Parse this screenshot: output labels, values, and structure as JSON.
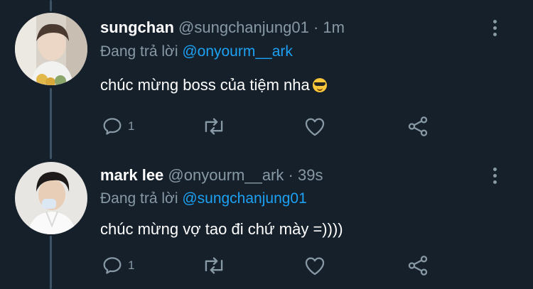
{
  "tweets": [
    {
      "name": "sungchan",
      "handle": "@sungchanjung01",
      "separator": "·",
      "time": "1m",
      "reply_prefix": "Đang trả lời",
      "reply_to": "@onyourm__ark",
      "text": "chúc mừng boss của tiệm nha",
      "emoji": "smiling-face-with-sunglasses",
      "reply_count": "1",
      "icons": [
        "reply-icon",
        "retweet-icon",
        "like-icon",
        "share-icon",
        "more-icon"
      ]
    },
    {
      "name": "mark lee",
      "handle": "@onyourm__ark",
      "separator": "·",
      "time": "39s",
      "reply_prefix": "Đang trả lời",
      "reply_to": "@sungchanjung01",
      "text": "chúc mừng vợ tao đi chứ mày =))))",
      "reply_count": "1",
      "icons": [
        "reply-icon",
        "retweet-icon",
        "like-icon",
        "share-icon",
        "more-icon"
      ]
    }
  ],
  "colors": {
    "background": "#15202b",
    "secondary_text": "#8899a6",
    "mention": "#1da1f2",
    "thread_line": "#3d5466"
  }
}
